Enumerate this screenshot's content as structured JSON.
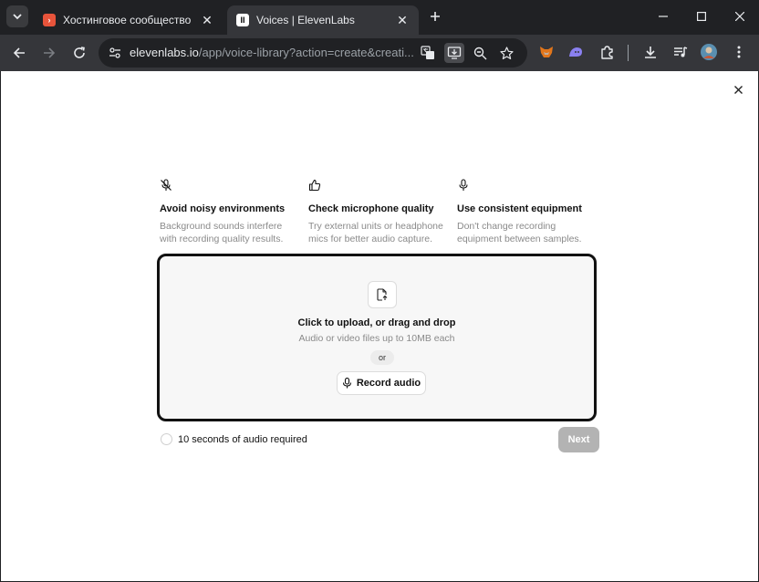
{
  "browser": {
    "tabs": [
      {
        "title": "Хостинговое сообщество «Tim",
        "favicon": "tj-logo-icon",
        "favicon_color": "#e8543b",
        "active": false
      },
      {
        "title": "Voices | ElevenLabs",
        "favicon": "elevenlabs-logo-icon",
        "favicon_color": "#ffffff",
        "active": true
      }
    ],
    "url_host": "elevenlabs.io",
    "url_path": "/app/voice-library?action=create&creati..."
  },
  "tips": [
    {
      "icon": "mic-off-icon",
      "title": "Avoid noisy environments",
      "desc_line1": "Background sounds interfere",
      "desc_line2": "with recording quality results."
    },
    {
      "icon": "thumbs-up-icon",
      "title": "Check microphone quality",
      "desc_line1": "Try external units or headphone",
      "desc_line2": "mics for better audio capture."
    },
    {
      "icon": "mic-icon",
      "title": "Use consistent equipment",
      "desc_line1": "Don't change recording",
      "desc_line2": "equipment between samples."
    }
  ],
  "dropzone": {
    "title": "Click to upload, or drag and drop",
    "subtitle": "Audio or video files up to 10MB each",
    "or_label": "or",
    "record_label": "Record audio"
  },
  "footer": {
    "requirement": "10 seconds of audio required",
    "progress": 0,
    "next_label": "Next"
  }
}
